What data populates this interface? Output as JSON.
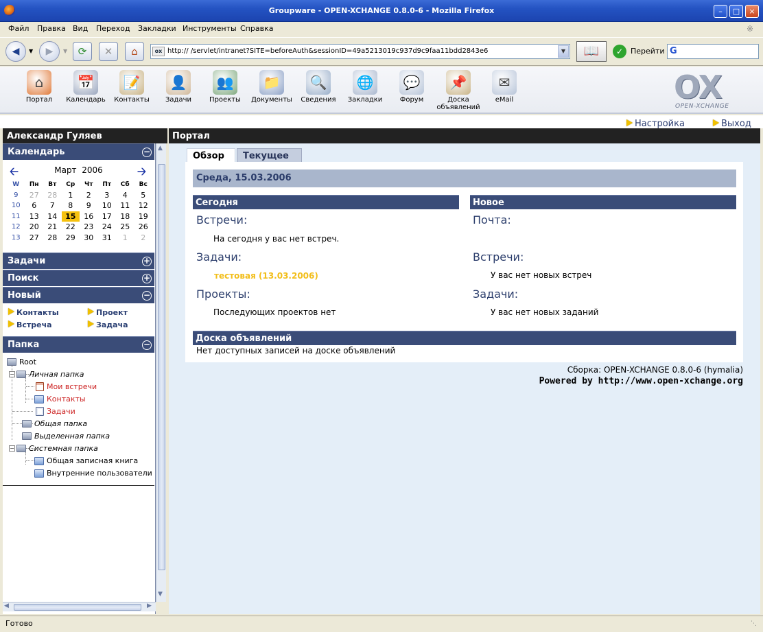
{
  "window": {
    "title": "Groupware - OPEN-XCHANGE 0.8.0-6 - Mozilla Firefox"
  },
  "menu": [
    "Файл",
    "Правка",
    "Вид",
    "Переход",
    "Закладки",
    "Инструменты",
    "Справка"
  ],
  "browser": {
    "url": "http://                    /servlet/intranet?SITE=beforeAuth&sessionID=49a5213019c937d9c9faa11bdd2843e6",
    "go_label": "Перейти",
    "search_glyph": "G"
  },
  "ox_toolbar": [
    {
      "label": "Портал",
      "icon": "home-icon"
    },
    {
      "label": "Календарь",
      "icon": "calendar-icon"
    },
    {
      "label": "Контакты",
      "icon": "contacts-icon"
    },
    {
      "label": "Задачи",
      "icon": "tasks-icon"
    },
    {
      "label": "Проекты",
      "icon": "projects-icon"
    },
    {
      "label": "Документы",
      "icon": "documents-icon"
    },
    {
      "label": "Сведения",
      "icon": "knowledge-icon"
    },
    {
      "label": "Закладки",
      "icon": "bookmarks-icon"
    },
    {
      "label": "Форум",
      "icon": "forum-icon"
    },
    {
      "label": "Доска объявлений",
      "icon": "pinboard-icon"
    },
    {
      "label": "eMail",
      "icon": "email-icon"
    }
  ],
  "logo": {
    "big": "OX",
    "small": "OPEN-XCHANGE"
  },
  "links": {
    "settings": "Настройка",
    "logout": "Выход"
  },
  "sidebar": {
    "user": "Александр Гуляев",
    "calendar": {
      "title": "Календарь",
      "month": "Март",
      "year": "2006",
      "weekday_header": [
        "W",
        "Пн",
        "Вт",
        "Ср",
        "Чт",
        "Пт",
        "Сб",
        "Вс"
      ],
      "weeks": [
        {
          "w": "9",
          "days": [
            "27",
            "28",
            "1",
            "2",
            "3",
            "4",
            "5"
          ]
        },
        {
          "w": "10",
          "days": [
            "6",
            "7",
            "8",
            "9",
            "10",
            "11",
            "12"
          ]
        },
        {
          "w": "11",
          "days": [
            "13",
            "14",
            "15",
            "16",
            "17",
            "18",
            "19"
          ]
        },
        {
          "w": "12",
          "days": [
            "20",
            "21",
            "22",
            "23",
            "24",
            "25",
            "26"
          ]
        },
        {
          "w": "13",
          "days": [
            "27",
            "28",
            "29",
            "30",
            "31",
            "1",
            "2"
          ]
        }
      ]
    },
    "tasks_title": "Задачи",
    "search_title": "Поиск",
    "new": {
      "title": "Новый",
      "items": [
        "Контакты",
        "Проект",
        "Встреча",
        "Задача"
      ]
    },
    "folder": {
      "title": "Папка",
      "root": "Root",
      "personal": "Личная папка",
      "my_appointments": "Мои встречи",
      "contacts": "Контакты",
      "tasks": "Задачи",
      "shared": "Общая папка",
      "dedicated": "Выделенная папка",
      "system": "Системная папка",
      "global_address": "Общая записная книга",
      "internal_users": "Внутренние пользователи"
    }
  },
  "main": {
    "title": "Портал",
    "tabs": [
      "Обзор",
      "Текущее"
    ],
    "date": "Среда, 15.03.2006",
    "today": {
      "title": "Сегодня",
      "appointments_h": "Встречи:",
      "appointments_t": "На сегодня у вас нет встреч.",
      "tasks_h": "Задачи:",
      "task_item": "тестовая (13.03.2006)",
      "projects_h": "Проекты:",
      "projects_t": "Последующих проектов нет"
    },
    "new": {
      "title": "Новое",
      "mail_h": "Почта:",
      "appointments_h": "Встречи:",
      "appointments_t": "У вас нет новых встреч",
      "tasks_h": "Задачи:",
      "tasks_t": "У вас нет новых заданий"
    },
    "board": {
      "title": "Доска объявлений",
      "text": "Нет доступных записей на доске объявлений"
    },
    "build": "Сборка: OPEN-XCHANGE 0.8.0-6 (hymalia)",
    "powered": "Powered by http://www.open-xchange.org"
  },
  "status": "Готово",
  "colors": {
    "header": "#3A4C78",
    "today_hl": "#F5C10E",
    "task": "#F2BE1A",
    "link_red": "#CC2222"
  }
}
